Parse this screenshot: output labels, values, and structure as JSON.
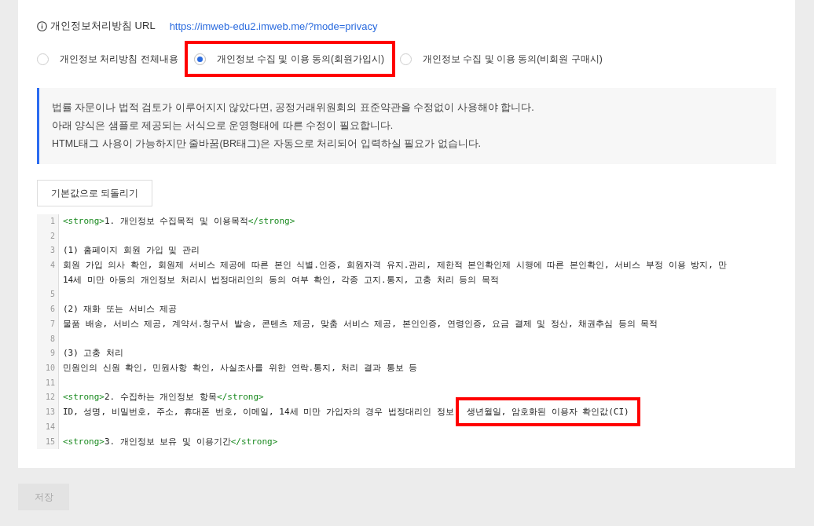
{
  "url_row": {
    "label": "개인정보처리방침 URL",
    "link": "https://imweb-edu2.imweb.me/?mode=privacy"
  },
  "options": [
    {
      "label": "개인정보 처리방침 전체내용",
      "selected": false,
      "highlighted": false
    },
    {
      "label": "개인정보 수집 및 이용 동의(회원가입시)",
      "selected": true,
      "highlighted": true
    },
    {
      "label": "개인정보 수집 및 이용 동의(비회원 구매시)",
      "selected": false,
      "highlighted": false
    }
  ],
  "notice": [
    "법률 자문이나 법적 검토가 이루어지지 않았다면, 공정거래위원회의 표준약관을 수정없이 사용해야 합니다.",
    "아래 양식은 샘플로 제공되는 서식으로 운영형태에 따른 수정이 필요합니다.",
    "HTML태그 사용이 가능하지만 줄바꿈(BR태그)은 자동으로 처리되어 입력하실 필요가 없습니다."
  ],
  "reset_button": "기본값으로 되돌리기",
  "editor_lines": [
    {
      "number": "1",
      "rows": [
        [
          {
            "kind": "tag",
            "text": "<strong>"
          },
          {
            "kind": "text",
            "text": "1. 개인정보 수집목적 및 이용목적"
          },
          {
            "kind": "tag",
            "text": "</strong>"
          }
        ]
      ]
    },
    {
      "number": "2",
      "rows": [
        []
      ]
    },
    {
      "number": "3",
      "rows": [
        [
          {
            "kind": "text",
            "text": "(1) 홈페이지 회원 가입 및 관리"
          }
        ]
      ]
    },
    {
      "number": "4",
      "rows": [
        [
          {
            "kind": "text",
            "text": "회원 가입 의사 확인, 회원제 서비스 제공에 따른 본인 식별.인증, 회원자격 유지.관리, 제한적 본인확인제 시행에 따른 본인확인, 서비스 부정 이용 방지, 만"
          }
        ],
        [
          {
            "kind": "text",
            "text": "14세 미만 아동의 개인정보 처리시 법정대리인의 동의 여부 확인, 각종 고지.통지, 고충 처리 등의 목적"
          }
        ]
      ]
    },
    {
      "number": "5",
      "rows": [
        []
      ]
    },
    {
      "number": "6",
      "rows": [
        [
          {
            "kind": "text",
            "text": "(2) 재화 또는 서비스 제공"
          }
        ]
      ]
    },
    {
      "number": "7",
      "rows": [
        [
          {
            "kind": "text",
            "text": "물품 배송, 서비스 제공, 계약서.청구서 발송, 콘텐츠 제공, 맞춤 서비스 제공, 본인인증, 연령인증, 요금 결제 및 정산, 채권추심 등의 목적"
          }
        ]
      ]
    },
    {
      "number": "8",
      "rows": [
        []
      ]
    },
    {
      "number": "9",
      "rows": [
        [
          {
            "kind": "text",
            "text": "(3) 고충 처리"
          }
        ]
      ]
    },
    {
      "number": "10",
      "rows": [
        [
          {
            "kind": "text",
            "text": "민원인의 신원 확인, 민원사항 확인, 사실조사를 위한 연락.통지, 처리 결과 통보 등"
          }
        ]
      ]
    },
    {
      "number": "11",
      "rows": [
        []
      ]
    },
    {
      "number": "12",
      "rows": [
        [
          {
            "kind": "tag",
            "text": "<strong>"
          },
          {
            "kind": "text",
            "text": "2. 수집하는 개인정보 항목"
          },
          {
            "kind": "tag",
            "text": "</strong>"
          }
        ]
      ]
    },
    {
      "number": "13",
      "rows": [
        [
          {
            "kind": "text",
            "text": "ID, 성명, 비밀번호, 주소, 휴대폰 번호, 이메일, 14세 미만 가입자의 경우 법정대리인 정보"
          },
          {
            "kind": "highlight",
            "text": "생년월일, 암호화된 이용자 확인값(CI)"
          }
        ]
      ]
    },
    {
      "number": "14",
      "rows": [
        []
      ]
    },
    {
      "number": "15",
      "rows": [
        [
          {
            "kind": "tag",
            "text": "<strong>"
          },
          {
            "kind": "text",
            "text": "3. 개인정보 보유 및 이용기간"
          },
          {
            "kind": "tag",
            "text": "</strong>"
          }
        ]
      ]
    }
  ],
  "save_button": "저장"
}
